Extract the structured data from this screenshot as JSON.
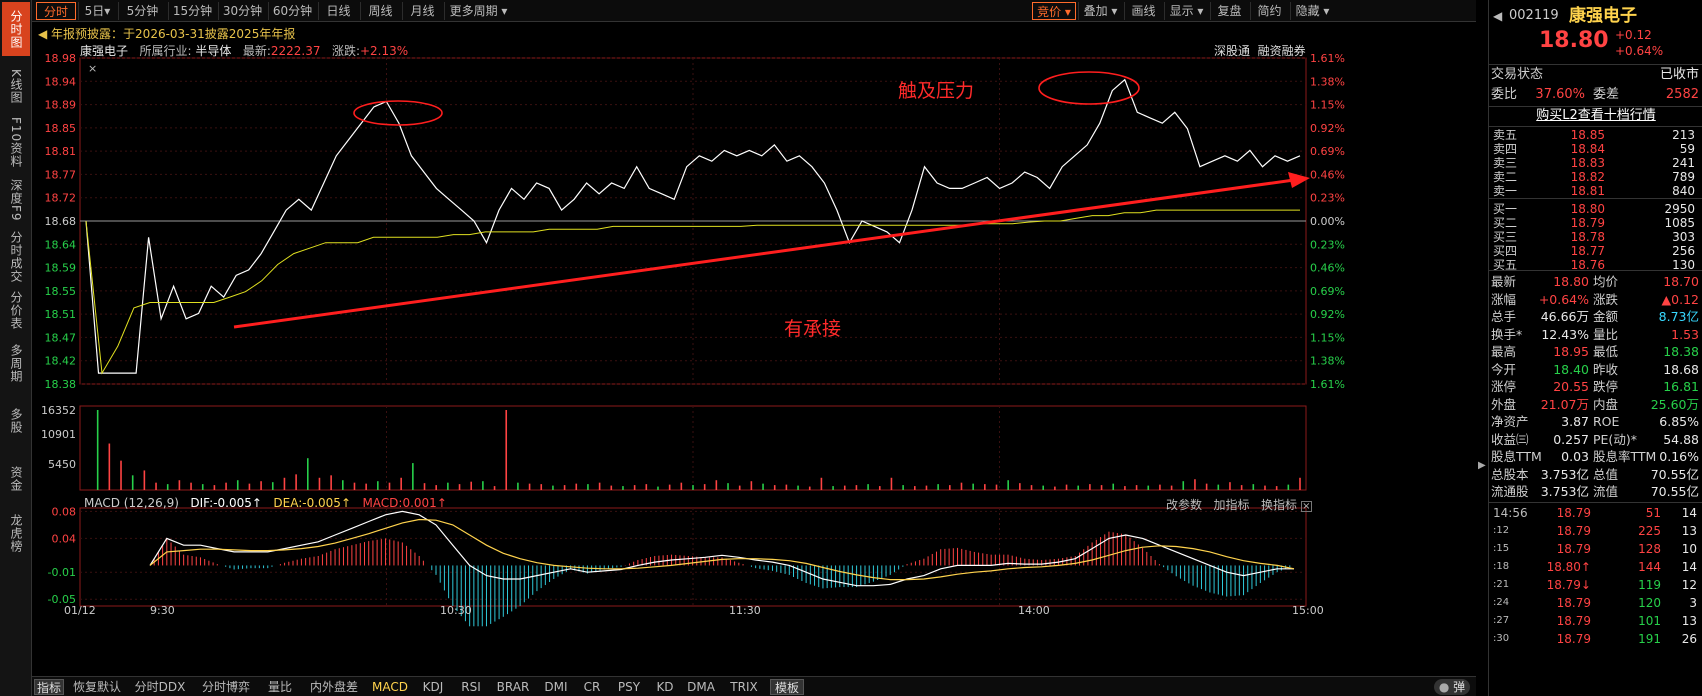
{
  "left_rail": {
    "items": [
      {
        "label": "分时图",
        "active": true
      },
      {
        "label": "K线图"
      },
      {
        "label": "F10资料"
      },
      {
        "label": "深度F9"
      },
      {
        "label": "分时成交"
      },
      {
        "label": "分价表"
      },
      {
        "label": "多周期"
      },
      {
        "label": "多股"
      },
      {
        "label": "资金"
      },
      {
        "label": "龙虎榜"
      }
    ]
  },
  "toolbar": {
    "period_tabs": [
      "分时",
      "5日▾",
      "5分钟",
      "15分钟",
      "30分钟",
      "60分钟",
      "日线",
      "周线",
      "月线",
      "更多周期 ▾"
    ],
    "right_tabs": [
      "竞价 ▾",
      "叠加 ▾",
      "画线",
      "显示 ▾",
      "复盘",
      "简约",
      "隐藏 ▾"
    ]
  },
  "notice": "年报预披露：于2026-03-31披露2025年年报",
  "info_bar": {
    "name": "康强电子",
    "industry_label": "所属行业:",
    "industry": "半导体",
    "index_label": "最新:",
    "index_value": "2222.37",
    "change_label": "涨跌:",
    "change_value": "+2.13%",
    "right_links": [
      "深股通",
      "融资融券"
    ]
  },
  "annotations": {
    "resistance": "触及压力",
    "support": "有承接"
  },
  "volume_panel": {
    "max_label": "16352",
    "mid_label": "10901",
    "low_label": "5450"
  },
  "macd_panel": {
    "title": "MACD (12,26,9)",
    "dif": "DIF:-0.005↑",
    "dea": "DEA:-0.005↑",
    "macd": "MACD:0.001↑",
    "buttons": [
      "改参数",
      "加指标",
      "换指标"
    ],
    "y_labels": [
      "0.08",
      "0.04",
      "-0.01",
      "-0.05"
    ]
  },
  "bottom_tabs": [
    "指标",
    "恢复默认",
    "分时DDX",
    "分时博弈",
    "量比",
    "内外盘差",
    "MACD",
    "KDJ",
    "RSI",
    "BRAR",
    "DMI",
    "CR",
    "PSY",
    "KD",
    "DMA",
    "TRIX",
    "模板"
  ],
  "bounce_button": "弹",
  "colors": {
    "up": "#ff4343",
    "down": "#27d04a",
    "price_line": "#ffffff",
    "avg_line": "#e0e020",
    "trend_arrow": "#ff1e1e",
    "accent": "#ff6b2b"
  },
  "chart_data": {
    "type": "line",
    "x_tick_labels": [
      "01/12",
      "9:30",
      "10:30",
      "11:30",
      "14:00",
      "15:00"
    ],
    "y_price_ticks": [
      "18.98",
      "18.94",
      "18.89",
      "18.85",
      "18.81",
      "18.77",
      "18.72",
      "18.68",
      "18.64",
      "18.59",
      "18.55",
      "18.51",
      "18.47",
      "18.42",
      "18.38"
    ],
    "y_pct_ticks": [
      "1.61%",
      "1.38%",
      "1.15%",
      "0.92%",
      "0.69%",
      "0.46%",
      "0.23%",
      "0.00%",
      "0.23%",
      "0.46%",
      "0.69%",
      "0.92%",
      "1.15%",
      "1.38%",
      "1.61%"
    ],
    "ylim": [
      18.38,
      18.98
    ],
    "prev_close": 18.68,
    "price_series": [
      18.68,
      18.4,
      18.4,
      18.4,
      18.4,
      18.65,
      18.5,
      18.56,
      18.5,
      18.51,
      18.56,
      18.54,
      18.58,
      18.59,
      18.62,
      18.66,
      18.7,
      18.72,
      18.7,
      18.75,
      18.8,
      18.83,
      18.86,
      18.89,
      18.9,
      18.86,
      18.8,
      18.77,
      18.74,
      18.72,
      18.7,
      18.68,
      18.64,
      18.7,
      18.74,
      18.72,
      18.75,
      18.74,
      18.7,
      18.72,
      18.75,
      18.73,
      18.75,
      18.74,
      18.78,
      18.74,
      18.73,
      18.72,
      18.78,
      18.8,
      18.79,
      18.81,
      18.8,
      18.81,
      18.8,
      18.82,
      18.79,
      18.8,
      18.78,
      18.75,
      18.7,
      18.64,
      18.68,
      18.67,
      18.66,
      18.64,
      18.7,
      18.78,
      18.75,
      18.74,
      18.74,
      18.75,
      18.76,
      18.74,
      18.75,
      18.77,
      18.76,
      18.74,
      18.78,
      18.8,
      18.82,
      18.86,
      18.92,
      18.94,
      18.88,
      18.87,
      18.86,
      18.88,
      18.85,
      18.78,
      18.79,
      18.8,
      18.79,
      18.81,
      18.78,
      18.8,
      18.79,
      18.8
    ],
    "avg_series": [
      18.68,
      18.4,
      18.45,
      18.52,
      18.53,
      18.53,
      18.53,
      18.53,
      18.53,
      18.54,
      18.55,
      18.57,
      18.6,
      18.62,
      18.63,
      18.64,
      18.64,
      18.64,
      18.65,
      18.65,
      18.65,
      18.65,
      18.65,
      18.655,
      18.655,
      18.66,
      18.66,
      18.66,
      18.66,
      18.665,
      18.665,
      18.665,
      18.665,
      18.67,
      18.67,
      18.67,
      18.67,
      18.67,
      18.67,
      18.67,
      18.67,
      18.67,
      18.672,
      18.672,
      18.672,
      18.672,
      18.672,
      18.672,
      18.672,
      18.672,
      18.672,
      18.672,
      18.672,
      18.672,
      18.672,
      18.672,
      18.675,
      18.675,
      18.675,
      18.678,
      18.68,
      18.68,
      18.685,
      18.69,
      18.69,
      18.695,
      18.695,
      18.7,
      18.7,
      18.7,
      18.7,
      18.7,
      18.7,
      18.7,
      18.7,
      18.7,
      18.7
    ],
    "volume_series": [
      0,
      16352,
      9500,
      6000,
      3000,
      4000,
      1500,
      1200,
      2000,
      1500,
      1200,
      1000,
      1500,
      2000,
      1300,
      1800,
      1600,
      2500,
      3200,
      6500,
      2500,
      3000,
      2000,
      1500,
      1300,
      1800,
      1500,
      2500,
      5500,
      1400,
      1000,
      1500,
      1200,
      1700,
      1800,
      800,
      16352,
      1500,
      1300,
      1200,
      900,
      1000,
      1300,
      1200,
      1500,
      900,
      800,
      1000,
      1200,
      700,
      1100,
      1500,
      1000,
      1200,
      2000,
      1400,
      900,
      1800,
      1300,
      1000,
      1100,
      900,
      700,
      2500,
      800,
      900,
      1000,
      1200,
      800,
      2500,
      1000,
      800,
      900,
      1200,
      1000,
      1500,
      1300,
      1200,
      1100,
      2000,
      1400,
      1000,
      900,
      700,
      1100,
      900,
      1200,
      1000,
      1300,
      800,
      1000,
      900,
      1100,
      900,
      1800,
      2200,
      1300,
      1100,
      1600,
      1000,
      1200,
      900,
      800,
      1100,
      2500
    ],
    "macd_dif": [
      0.0,
      0.04,
      0.03,
      0.03,
      0.025,
      0.02,
      0.02,
      0.02,
      0.025,
      0.03,
      0.035,
      0.045,
      0.055,
      0.065,
      0.075,
      0.08,
      0.075,
      0.06,
      0.03,
      0.0,
      -0.015,
      -0.02,
      -0.02,
      -0.015,
      -0.01,
      -0.005,
      -0.01,
      -0.008,
      -0.006,
      0.0,
      0.005,
      0.008,
      0.01,
      0.012,
      0.015,
      0.012,
      0.008,
      0.005,
      0.0,
      -0.01,
      -0.02,
      -0.025,
      -0.03,
      -0.03,
      -0.028,
      -0.02,
      -0.015,
      -0.005,
      0.0,
      0.0,
      0.0,
      0.003,
      0.002,
      0.002,
      0.005,
      0.01,
      0.025,
      0.04,
      0.045,
      0.04,
      0.03,
      0.02,
      0.01,
      0.0,
      -0.01,
      -0.015,
      -0.01,
      -0.005,
      -0.005
    ],
    "macd_dea": [
      0.0,
      0.02,
      0.022,
      0.024,
      0.024,
      0.023,
      0.022,
      0.022,
      0.023,
      0.025,
      0.028,
      0.033,
      0.04,
      0.047,
      0.055,
      0.063,
      0.068,
      0.067,
      0.06,
      0.045,
      0.03,
      0.018,
      0.01,
      0.004,
      0.0,
      -0.002,
      -0.004,
      -0.005,
      -0.005,
      -0.004,
      -0.002,
      0.0,
      0.003,
      0.006,
      0.009,
      0.01,
      0.01,
      0.009,
      0.007,
      0.003,
      -0.003,
      -0.009,
      -0.014,
      -0.018,
      -0.021,
      -0.021,
      -0.02,
      -0.017,
      -0.013,
      -0.01,
      -0.008,
      -0.005,
      -0.003,
      -0.002,
      0.0,
      0.003,
      0.008,
      0.015,
      0.022,
      0.027,
      0.029,
      0.028,
      0.025,
      0.02,
      0.013,
      0.007,
      0.003,
      0.0,
      -0.005
    ]
  },
  "quote_panel": {
    "code": "002119",
    "name": "康强电子",
    "price": "18.80",
    "change": "+0.12",
    "change_pct": "+0.64%",
    "trade_state_label": "交易状态",
    "trade_state": "已收市",
    "weibi_label": "委比",
    "weibi": "37.60%",
    "weicha_label": "委差",
    "weicha": "2582",
    "l2_link": "购买L2查看十档行情",
    "asks": [
      {
        "label": "卖五",
        "price": "18.85",
        "vol": "213"
      },
      {
        "label": "卖四",
        "price": "18.84",
        "vol": "59"
      },
      {
        "label": "卖三",
        "price": "18.83",
        "vol": "241"
      },
      {
        "label": "卖二",
        "price": "18.82",
        "vol": "789"
      },
      {
        "label": "卖一",
        "price": "18.81",
        "vol": "840"
      }
    ],
    "bids": [
      {
        "label": "买一",
        "price": "18.80",
        "vol": "2950"
      },
      {
        "label": "买二",
        "price": "18.79",
        "vol": "1085"
      },
      {
        "label": "买三",
        "price": "18.78",
        "vol": "303"
      },
      {
        "label": "买四",
        "price": "18.77",
        "vol": "256"
      },
      {
        "label": "买五",
        "price": "18.76",
        "vol": "130"
      }
    ],
    "stats": [
      {
        "l1": "最新",
        "v1": "18.80",
        "c1": "red",
        "l2": "均价",
        "v2": "18.70",
        "c2": "red"
      },
      {
        "l1": "涨幅",
        "v1": "+0.64%",
        "c1": "red",
        "l2": "涨跌",
        "v2": "▲0.12",
        "c2": "red"
      },
      {
        "l1": "总手",
        "v1": "46.66万",
        "c1": "white",
        "l2": "金额",
        "v2": "8.73亿",
        "c2": "cyan"
      },
      {
        "l1": "换手*",
        "v1": "12.43%",
        "c1": "white",
        "l2": "量比",
        "v2": "1.53",
        "c2": "red"
      },
      {
        "l1": "最高",
        "v1": "18.95",
        "c1": "red",
        "l2": "最低",
        "v2": "18.38",
        "c2": "green"
      },
      {
        "l1": "今开",
        "v1": "18.40",
        "c1": "green",
        "l2": "昨收",
        "v2": "18.68",
        "c2": "white"
      },
      {
        "l1": "涨停",
        "v1": "20.55",
        "c1": "red",
        "l2": "跌停",
        "v2": "16.81",
        "c2": "green"
      },
      {
        "l1": "外盘",
        "v1": "21.07万",
        "c1": "red",
        "l2": "内盘",
        "v2": "25.60万",
        "c2": "green"
      },
      {
        "l1": "净资产",
        "v1": "3.87",
        "c1": "white",
        "l2": "ROE",
        "v2": "6.85%",
        "c2": "white"
      },
      {
        "l1": "收益㈢",
        "v1": "0.257",
        "c1": "white",
        "l2": "PE(动)*",
        "v2": "54.88",
        "c2": "white"
      },
      {
        "l1": "股息TTM",
        "v1": "0.03",
        "c1": "white",
        "l2": "股息率TTM",
        "v2": "0.16%",
        "c2": "white"
      },
      {
        "l1": "总股本",
        "v1": "3.753亿",
        "c1": "white",
        "l2": "总值",
        "v2": "70.55亿",
        "c2": "white"
      },
      {
        "l1": "流通股",
        "v1": "3.753亿",
        "c1": "white",
        "l2": "流值",
        "v2": "70.55亿",
        "c2": "white"
      }
    ],
    "ticks": [
      {
        "time": "14:56",
        "price": "18.79",
        "vol": "51",
        "n": "14",
        "vc": "red"
      },
      {
        "time": ":12",
        "price": "18.79",
        "vol": "225",
        "n": "13",
        "vc": "red"
      },
      {
        "time": ":15",
        "price": "18.79",
        "vol": "128",
        "n": "10",
        "vc": "red"
      },
      {
        "time": ":18",
        "price": "18.80↑",
        "vol": "144",
        "n": "14",
        "vc": "red"
      },
      {
        "time": ":21",
        "price": "18.79↓",
        "vol": "119",
        "n": "12",
        "vc": "green"
      },
      {
        "time": ":24",
        "price": "18.79",
        "vol": "120",
        "n": "3",
        "vc": "green"
      },
      {
        "time": ":27",
        "price": "18.79",
        "vol": "101",
        "n": "13",
        "vc": "green"
      },
      {
        "time": ":30",
        "price": "18.79",
        "vol": "191",
        "n": "26",
        "vc": "green"
      }
    ]
  }
}
